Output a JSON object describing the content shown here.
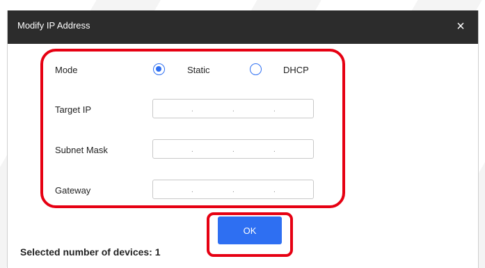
{
  "dialog": {
    "title": "Modify IP Address",
    "close_glyph": "×"
  },
  "form": {
    "mode_label": "Mode",
    "mode_options": [
      {
        "label": "Static",
        "selected": true
      },
      {
        "label": "DHCP",
        "selected": false
      }
    ],
    "target_ip_label": "Target IP",
    "subnet_mask_label": "Subnet Mask",
    "gateway_label": "Gateway",
    "ip_separator": "."
  },
  "actions": {
    "ok_label": "OK"
  },
  "footer": {
    "selected_devices_text": "Selected number of devices: 1"
  },
  "colors": {
    "accent": "#2e6ff2",
    "highlight": "#e60012",
    "titlebar": "#2c2c2c"
  },
  "icons": {
    "close": "close-icon",
    "radio": "radio-icon"
  }
}
